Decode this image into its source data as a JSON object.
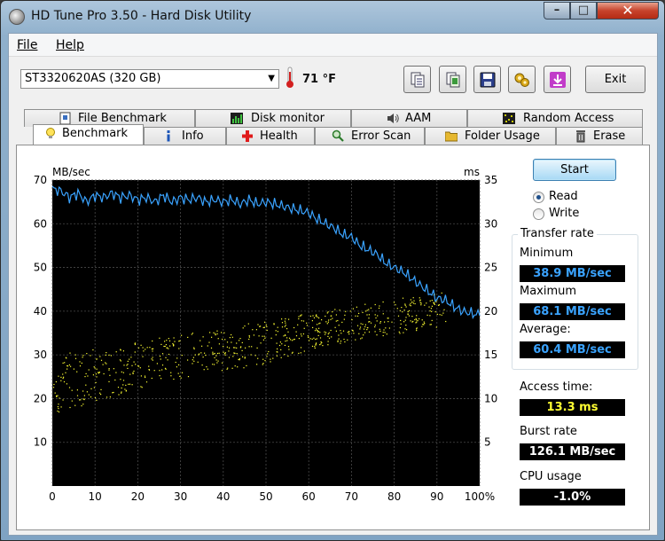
{
  "window": {
    "title": "HD Tune Pro 3.50 - Hard Disk Utility",
    "controls": [
      "–",
      "□",
      "✕"
    ]
  },
  "menu": {
    "items": [
      {
        "label": "File"
      },
      {
        "label": "Help"
      }
    ]
  },
  "toolbar": {
    "drive": "ST3320620AS (320 GB)",
    "temperature": "71 °F",
    "buttons": [
      "copy-info-icon",
      "copy-screenshot-icon",
      "save-icon",
      "options-icon",
      "download-icon"
    ],
    "exit_label": "Exit"
  },
  "tabs": {
    "row1": [
      {
        "label": "File Benchmark",
        "icon": "file-benchmark-icon"
      },
      {
        "label": "Disk monitor",
        "icon": "disk-monitor-icon"
      },
      {
        "label": "AAM",
        "icon": "speaker-icon"
      },
      {
        "label": "Random Access",
        "icon": "random-access-icon"
      }
    ],
    "row2": [
      {
        "label": "Benchmark",
        "icon": "lightbulb-icon"
      },
      {
        "label": "Info",
        "icon": "info-icon"
      },
      {
        "label": "Health",
        "icon": "health-cross-icon"
      },
      {
        "label": "Error Scan",
        "icon": "magnifier-icon"
      },
      {
        "label": "Folder Usage",
        "icon": "folder-icon"
      },
      {
        "label": "Erase",
        "icon": "trash-icon"
      }
    ],
    "active": "Benchmark"
  },
  "controls": {
    "start_label": "Start",
    "read_label": "Read",
    "write_label": "Write",
    "mode": "Read"
  },
  "stats": {
    "transfer_rate_title": "Transfer rate",
    "minimum_label": "Minimum",
    "minimum_value": "38.9 MB/sec",
    "maximum_label": "Maximum",
    "maximum_value": "68.1 MB/sec",
    "average_label": "Average:",
    "average_value": "60.4 MB/sec",
    "access_label": "Access time:",
    "access_value": "13.3 ms",
    "burst_label": "Burst rate",
    "burst_value": "126.1 MB/sec",
    "cpu_label": "CPU usage",
    "cpu_value": "-1.0%"
  },
  "colors": {
    "transfer_line": "#3aa3ff",
    "access_dots": "#ffff33",
    "chart_bg": "#000000",
    "grid": "#4a4a4a"
  },
  "chart_data": {
    "type": "line",
    "ylabel_left": "MB/sec",
    "ylabel_right": "ms",
    "xlim": [
      0,
      100
    ],
    "ylim_left": [
      0,
      70
    ],
    "ylim_right": [
      0,
      35
    ],
    "x_ticks": [
      "0",
      "10",
      "20",
      "30",
      "40",
      "50",
      "60",
      "70",
      "80",
      "90",
      "100%"
    ],
    "y_ticks_left": [
      "10",
      "20",
      "30",
      "40",
      "50",
      "60",
      "70"
    ],
    "y_ticks_right": [
      "5",
      "10",
      "15",
      "20",
      "25",
      "30",
      "35"
    ],
    "grid": true,
    "series": [
      {
        "axis": "left",
        "x": [
          0,
          2,
          4,
          6,
          8,
          10,
          12,
          14,
          16,
          18,
          20,
          22,
          24,
          26,
          28,
          30,
          32,
          34,
          36,
          38,
          40,
          42,
          44,
          46,
          48,
          50,
          52,
          54,
          56,
          58,
          60,
          62,
          64,
          66,
          68,
          70,
          72,
          74,
          76,
          78,
          80,
          82,
          84,
          86,
          88,
          90,
          92,
          94,
          96,
          98,
          100
        ],
        "values": [
          68,
          67.5,
          66,
          67,
          65,
          66.5,
          66,
          67,
          66,
          66.5,
          65.5,
          66,
          65,
          66.5,
          65,
          66,
          65.5,
          66,
          65,
          65.5,
          65,
          65.5,
          64.5,
          65.5,
          64.5,
          65,
          64.5,
          64,
          63.5,
          63,
          62.5,
          61,
          60,
          59,
          57.5,
          57,
          55,
          54,
          53,
          51,
          50,
          49,
          47.5,
          46,
          44.5,
          43,
          42.5,
          41,
          40,
          39.5,
          39
        ]
      },
      {
        "axis": "right",
        "kind": "scatter",
        "band_left": [
          10,
          12,
          14,
          15,
          16,
          18,
          19,
          20,
          20.5
        ],
        "band_right": [
          13,
          14,
          15,
          16,
          17,
          18,
          19,
          20,
          21
        ],
        "band_x": [
          0,
          12.5,
          25,
          37.5,
          50,
          62.5,
          75,
          87.5,
          100
        ],
        "count": 700
      }
    ]
  }
}
